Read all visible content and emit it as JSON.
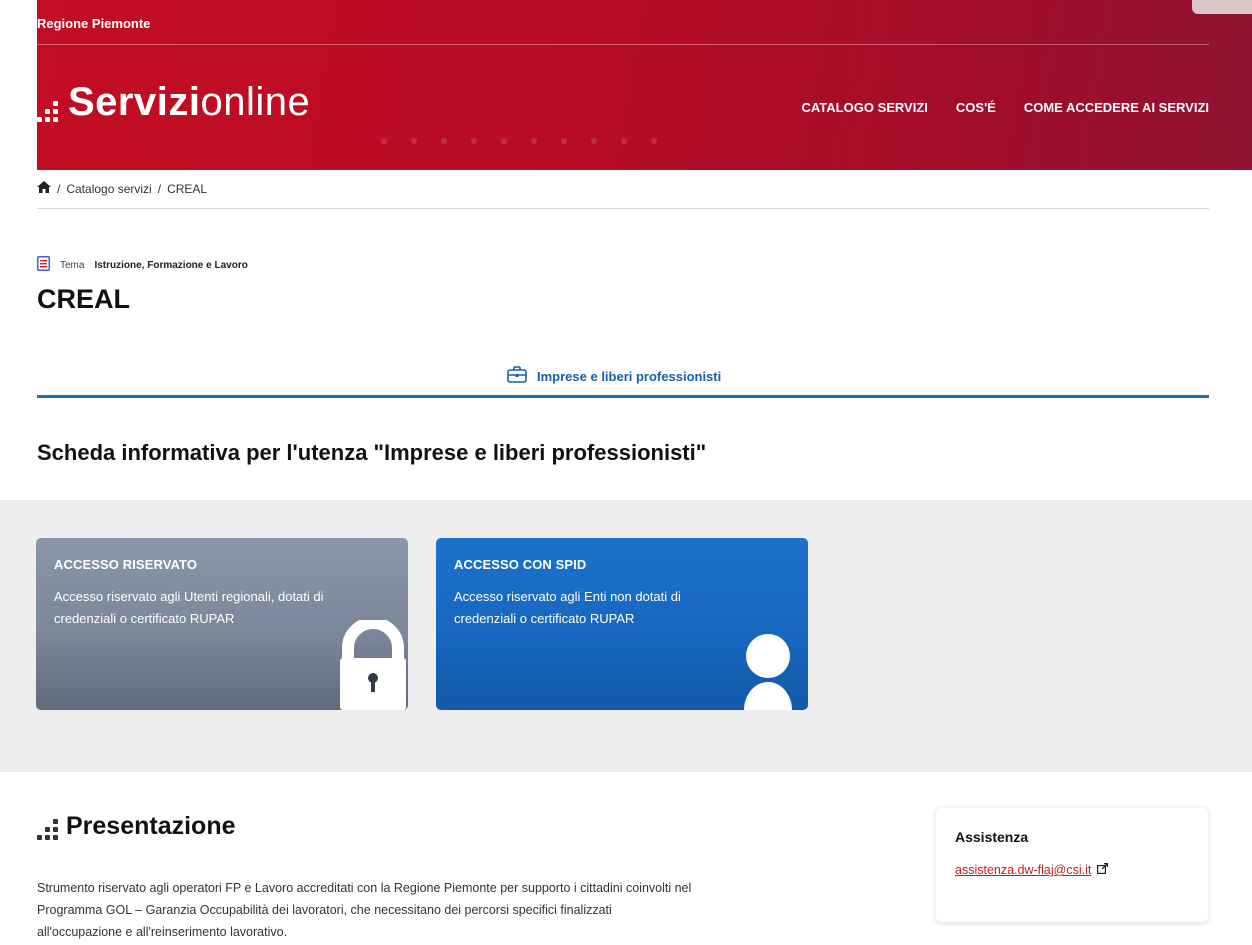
{
  "header": {
    "region": "Regione Piemonte",
    "logo_bold": "Servizi",
    "logo_light": "online",
    "nav": [
      "CATALOGO SERVIZI",
      "COS'É",
      "COME ACCEDERE AI SERVIZI"
    ]
  },
  "breadcrumb": {
    "home_icon": "home-icon",
    "sep": "/",
    "items": [
      "Catalogo servizi",
      "CREAL"
    ]
  },
  "tema": {
    "icon": "book-icon",
    "label": "Tema",
    "value": "Istruzione, Formazione e Lavoro"
  },
  "page_title": "CREAL",
  "tab": {
    "icon": "briefcase-icon",
    "label": "Imprese e liberi professionisti"
  },
  "section_title": "Scheda informativa per l'utenza \"Imprese e liberi professionisti\"",
  "cards": [
    {
      "title": "ACCESSO RISERVATO",
      "description": "Accesso riservato agli Utenti regionali, dotati di credenziali o certificato RUPAR",
      "icon": "lock-icon"
    },
    {
      "title": "ACCESSO CON SPID",
      "description": "Accesso riservato agli Enti non dotati di credenziali o certificato RUPAR",
      "icon": "user-icon"
    }
  ],
  "presentazione": {
    "title": "Presentazione",
    "text": "Strumento riservato agli operatori FP e Lavoro accreditati con la Regione Piemonte per supporto i cittadini coinvolti nel Programma GOL – Garanzia Occupabilità dei lavoratori, che necessitano dei percorsi specifici finalizzati all'occupazione e all'reinserimento lavorativo."
  },
  "assistenza": {
    "title": "Assistenza",
    "email": "assistenza.dw-flaj@csi.it",
    "icon": "external-link-icon"
  },
  "colors": {
    "header_red": "#c20d24",
    "accent_blue": "#1a6fc2",
    "spid_blue": "#1d72cc",
    "gray_card": "#7b879a",
    "link_red": "#c41c1c"
  }
}
